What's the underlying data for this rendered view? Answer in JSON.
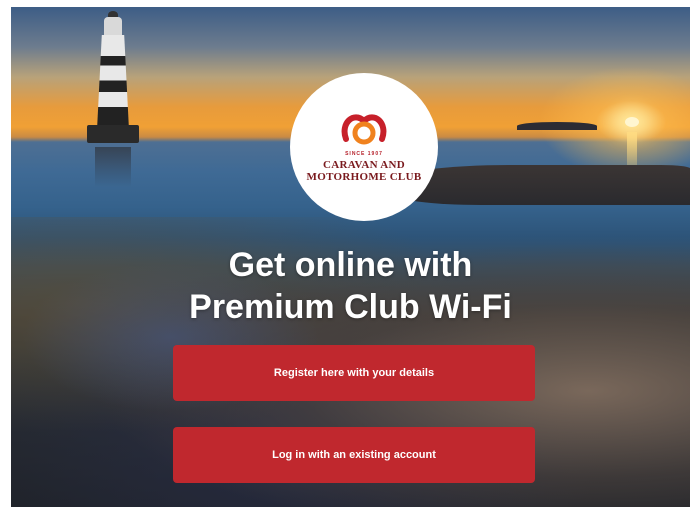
{
  "brand": {
    "since": "SINCE 1907",
    "name_line1": "CARAVAN AND",
    "name_line2": "MOTORHOME CLUB",
    "logo_colors": [
      "#c7202a",
      "#f0821e"
    ]
  },
  "headline": {
    "line1": "Get online with",
    "line2": "Premium Club Wi-Fi"
  },
  "actions": {
    "register_label": "Register here with your details",
    "login_label": "Log in with an existing account",
    "button_color": "#c0282e"
  },
  "background": {
    "icon": "lighthouse-sunset-photo"
  }
}
